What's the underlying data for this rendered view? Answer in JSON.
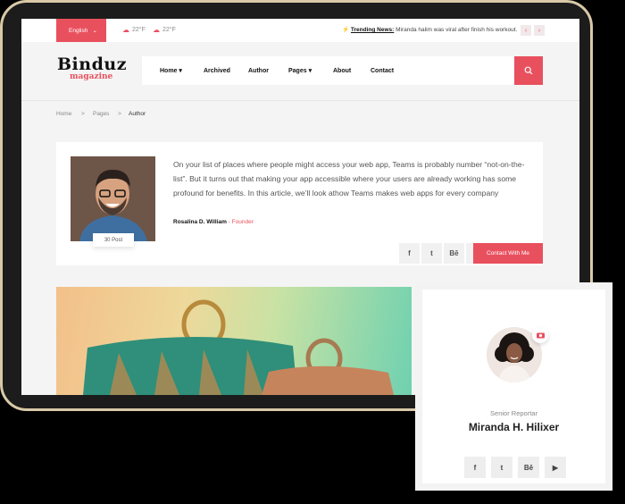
{
  "topbar": {
    "language": "English",
    "weather": [
      "22°F",
      "22°F"
    ],
    "trending_label": "Trending News:",
    "trending_text": "Miranda halim was viral after finish his workout.",
    "prev": "‹",
    "next": "›"
  },
  "header": {
    "logo_main": "Binduz",
    "logo_sub": "magazine",
    "nav": [
      "Home",
      "Archived",
      "Author",
      "Pages",
      "About",
      "Contact"
    ]
  },
  "breadcrumb": [
    "Home",
    ">",
    "Pages",
    ">",
    "Author"
  ],
  "author": {
    "bio": "On your list of places where people might access your web app, Teams is probably number “not-on-the-list”. But it turns out that making your app accessible where your users are already working has some profound for benefits. In this article, we’ll look athow Teams makes web apps for every company",
    "name": "Rosalina D. William",
    "role": " - Founder",
    "posts": "30 Post",
    "contact_label": "Contact With Me",
    "social": [
      "f",
      "t",
      "Bē",
      "▶"
    ]
  },
  "profile_card": {
    "role": "Senior Reportar",
    "name": "Miranda H. Hilixer",
    "social": [
      "f",
      "t",
      "Bē",
      "▶"
    ]
  },
  "colors": {
    "accent": "#e9505e"
  }
}
